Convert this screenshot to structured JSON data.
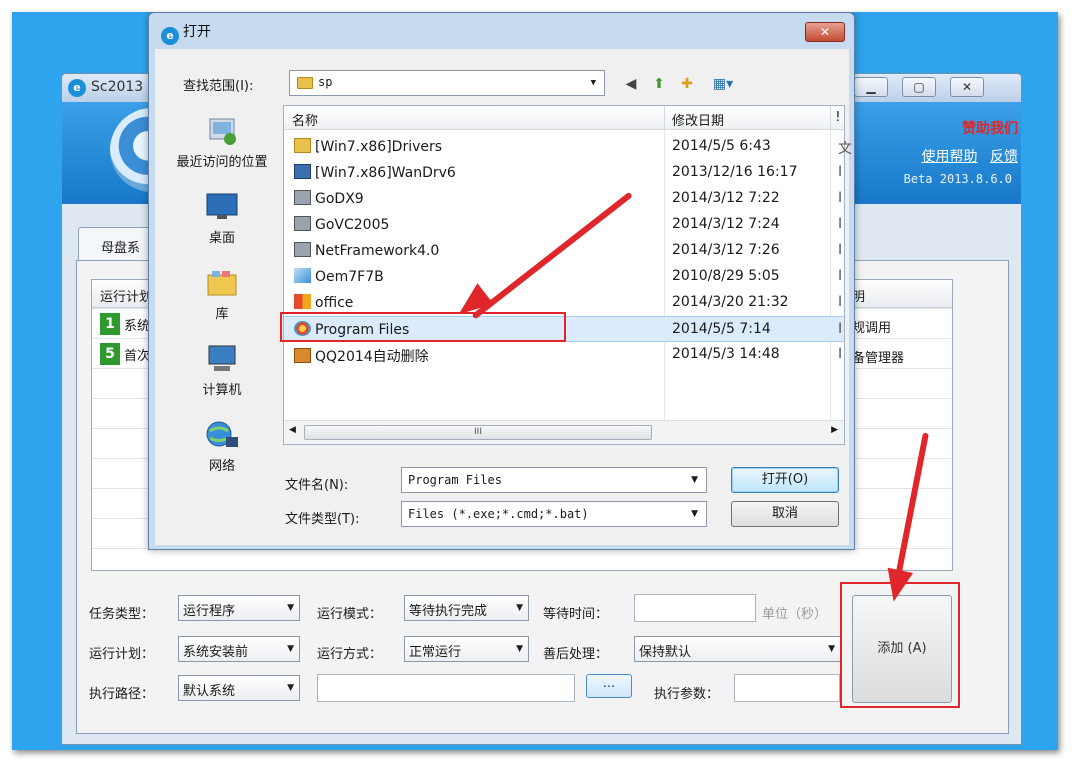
{
  "app": {
    "title": "Sc2013",
    "header_link_support": "赞助我们",
    "header_link_help": "使用帮助",
    "header_link_feedback": "反馈",
    "version": "Beta 2013.8.6.0",
    "tab_label": "母盘系",
    "grid": {
      "header_left": "运行计划",
      "header_right": "明",
      "rows": [
        {
          "num": "1",
          "text": "系统",
          "right": "规调用"
        },
        {
          "num": "5",
          "text": "首次",
          "right": "备管理器"
        }
      ]
    },
    "form": {
      "task_type_label": "任务类型：",
      "task_type_value": "运行程序",
      "run_mode_label": "运行模式：",
      "run_mode_value": "等待执行完成",
      "wait_time_label": "等待时间：",
      "wait_time_unit": "单位（秒）",
      "plan_label": "运行计划：",
      "plan_value": "系统安装前",
      "run_way_label": "运行方式：",
      "run_way_value": "正常运行",
      "post_label": "善后处理：",
      "post_value": "保持默认",
      "path_label": "执行路径：",
      "path_value": "默认系统",
      "browse_label": "...",
      "params_label": "执行参数：",
      "add_button": "添加 (A)"
    }
  },
  "dialog": {
    "title": "打开",
    "close_label": "✕",
    "look_in_label": "查找范围(I):",
    "look_in_value": "sp",
    "places": [
      "最近访问的位置",
      "桌面",
      "库",
      "计算机",
      "网络"
    ],
    "columns": {
      "name": "名称",
      "date": "修改日期"
    },
    "files": [
      {
        "name": "[Win7.x86]Drivers",
        "date": "2014/5/5 6:43",
        "more": "文",
        "icon": "folder-icon"
      },
      {
        "name": "[Win7.x86]WanDrv6",
        "date": "2013/12/16 16:17",
        "more": "I",
        "icon": "app-icon"
      },
      {
        "name": "GoDX9",
        "date": "2014/3/12 7:22",
        "more": "I",
        "icon": "window-icon"
      },
      {
        "name": "GoVC2005",
        "date": "2014/3/12 7:24",
        "more": "I",
        "icon": "window-icon"
      },
      {
        "name": "NetFramework4.0",
        "date": "2014/3/12 7:26",
        "more": "I",
        "icon": "window-icon"
      },
      {
        "name": "Oem7F7B",
        "date": "2010/8/29 5:05",
        "more": "I",
        "icon": "send-icon"
      },
      {
        "name": "office",
        "date": "2014/3/20 21:32",
        "more": "I",
        "icon": "office-icon"
      },
      {
        "name": "Program Files",
        "date": "2014/5/5 7:14",
        "more": "I",
        "icon": "program-icon"
      },
      {
        "name": "QQ2014自动删除",
        "date": "2014/5/3 14:48",
        "more": "I",
        "icon": "qq-icon"
      }
    ],
    "scroll_grip": "III",
    "file_name_label": "文件名(N):",
    "file_name_value": "Program Files",
    "file_type_label": "文件类型(T):",
    "file_type_value": "Files (*.exe;*.cmd;*.bat)",
    "open_button": "打开(O)",
    "cancel_button": "取消"
  },
  "colors": {
    "accent": "#2ea4ee",
    "annotation": "#e0262b",
    "selected_row": "#dcebfc"
  }
}
